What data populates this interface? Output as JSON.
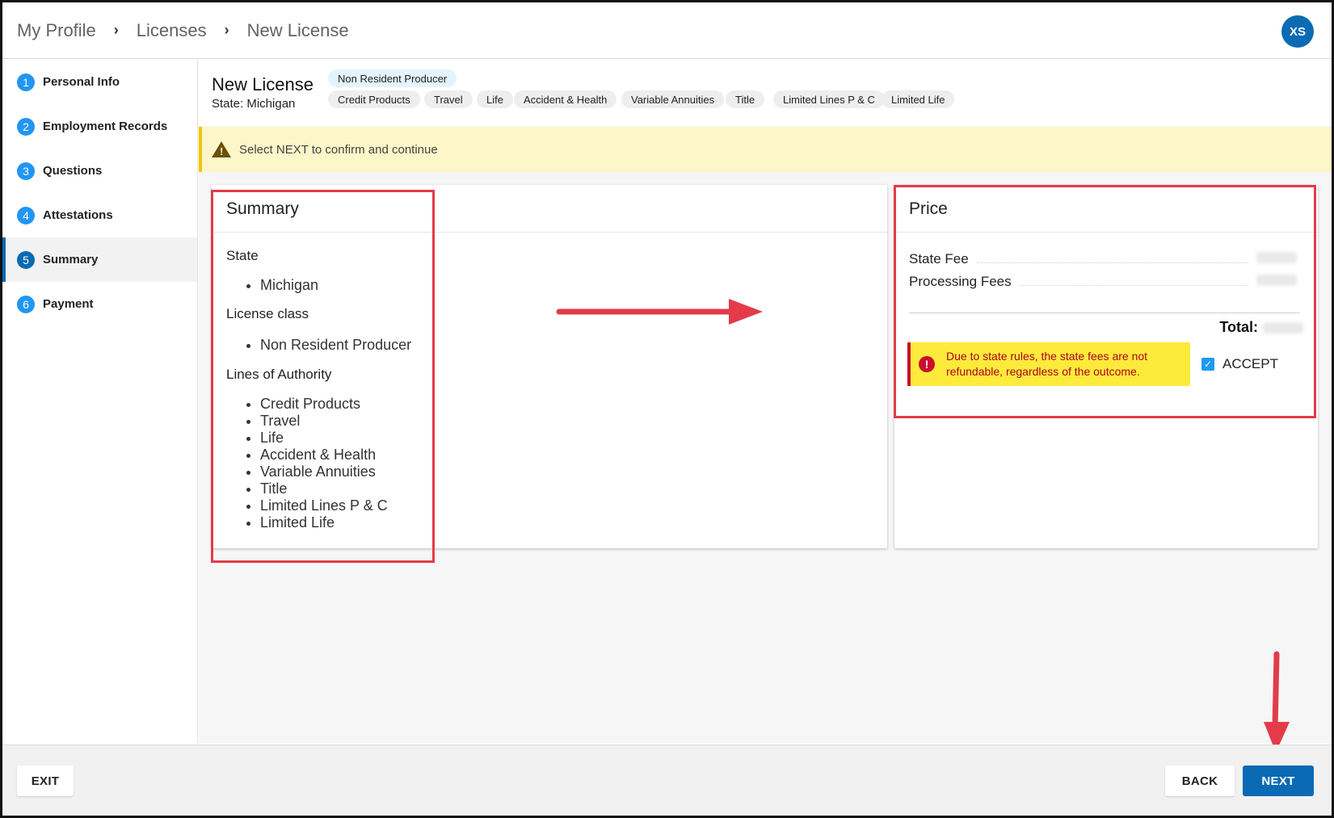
{
  "breadcrumb": [
    "My Profile",
    "Licenses",
    "New License"
  ],
  "user": {
    "initials": "XS"
  },
  "steps": [
    {
      "num": "1",
      "label": "Personal Info"
    },
    {
      "num": "2",
      "label": "Employment Records"
    },
    {
      "num": "3",
      "label": "Questions"
    },
    {
      "num": "4",
      "label": "Attestations"
    },
    {
      "num": "5",
      "label": "Summary"
    },
    {
      "num": "6",
      "label": "Payment"
    }
  ],
  "license": {
    "title": "New License",
    "state": "State: Michigan",
    "class_chip": "Non Resident Producer",
    "chips": [
      "Credit Products",
      "Travel",
      "Life",
      "Accident & Health",
      "Variable Annuities",
      "Title",
      "Limited Lines P & C",
      "Limited Life"
    ]
  },
  "warning": {
    "text": "Select NEXT to confirm and continue"
  },
  "summary": {
    "title": "Summary",
    "state_label": "State",
    "state_value": "Michigan",
    "class_label": "License class",
    "class_value": "Non Resident Producer",
    "lines_label": "Lines of Authority",
    "lines": [
      "Credit Products",
      "Travel",
      "Life",
      "Accident & Health",
      "Variable Annuities",
      "Title",
      "Limited Lines P & C",
      "Limited Life"
    ]
  },
  "price": {
    "title": "Price",
    "state_fee_label": "State Fee",
    "processing_fee_label": "Processing Fees",
    "total_label": "Total:",
    "alert": "Due to state rules, the state fees are not refundable, regardless of the outcome.",
    "accept_label": "ACCEPT",
    "accept_checked": true
  },
  "footer": {
    "exit": "EXIT",
    "back": "BACK",
    "next": "NEXT"
  },
  "colors": {
    "primary": "#0a6ab3",
    "step": "#2196f3",
    "warning_bg": "#fdf6c9",
    "alert_bg": "#fdeb3b",
    "alert_text": "#b00020",
    "annotation": "#e33b4a"
  }
}
